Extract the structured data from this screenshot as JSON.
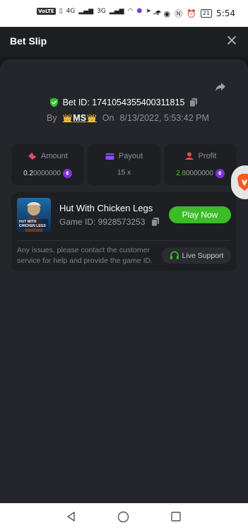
{
  "status_bar": {
    "sim_badge": "VoLTE",
    "network_1": "4G",
    "network_2": "3G",
    "battery": "21",
    "time": "5:54"
  },
  "header": {
    "title": "Bet Slip",
    "close_icon": "close-icon"
  },
  "bet": {
    "id_label": "Bet ID: 1741054355400311815",
    "by_label": "By",
    "user": "MS",
    "on_label": "On",
    "datetime": "8/13/2022, 5:53:42 PM"
  },
  "stats": {
    "amount": {
      "label": "Amount",
      "value_dim": "0.2",
      "value_rest": "0000000",
      "icon": "amount-icon"
    },
    "payout": {
      "label": "Payout",
      "value": "15 x",
      "icon": "payout-icon"
    },
    "profit": {
      "label": "Profit",
      "value_main": "2.8",
      "value_rest": "0000000",
      "icon": "profit-icon"
    }
  },
  "game": {
    "name": "Hut With Chicken Legs",
    "id_label": "Game ID: 9928573253",
    "play_label": "Play Now",
    "thumb_text_1": "HUT WITH",
    "thumb_text_2": "CHICKEN LEGS"
  },
  "support": {
    "issue_text": "Any issues, please contact the customer service for help and provide the game ID.",
    "button_label": "Live Support"
  },
  "colors": {
    "background": "#17181b",
    "sheet": "#24262b",
    "card": "#1d1f23",
    "accent_green": "#3bbd26",
    "coin_purple": "#7a34d8",
    "amount_pink": "#e84a6b",
    "payout_purple": "#8e4bf0",
    "profit_red": "#e94b4b"
  }
}
